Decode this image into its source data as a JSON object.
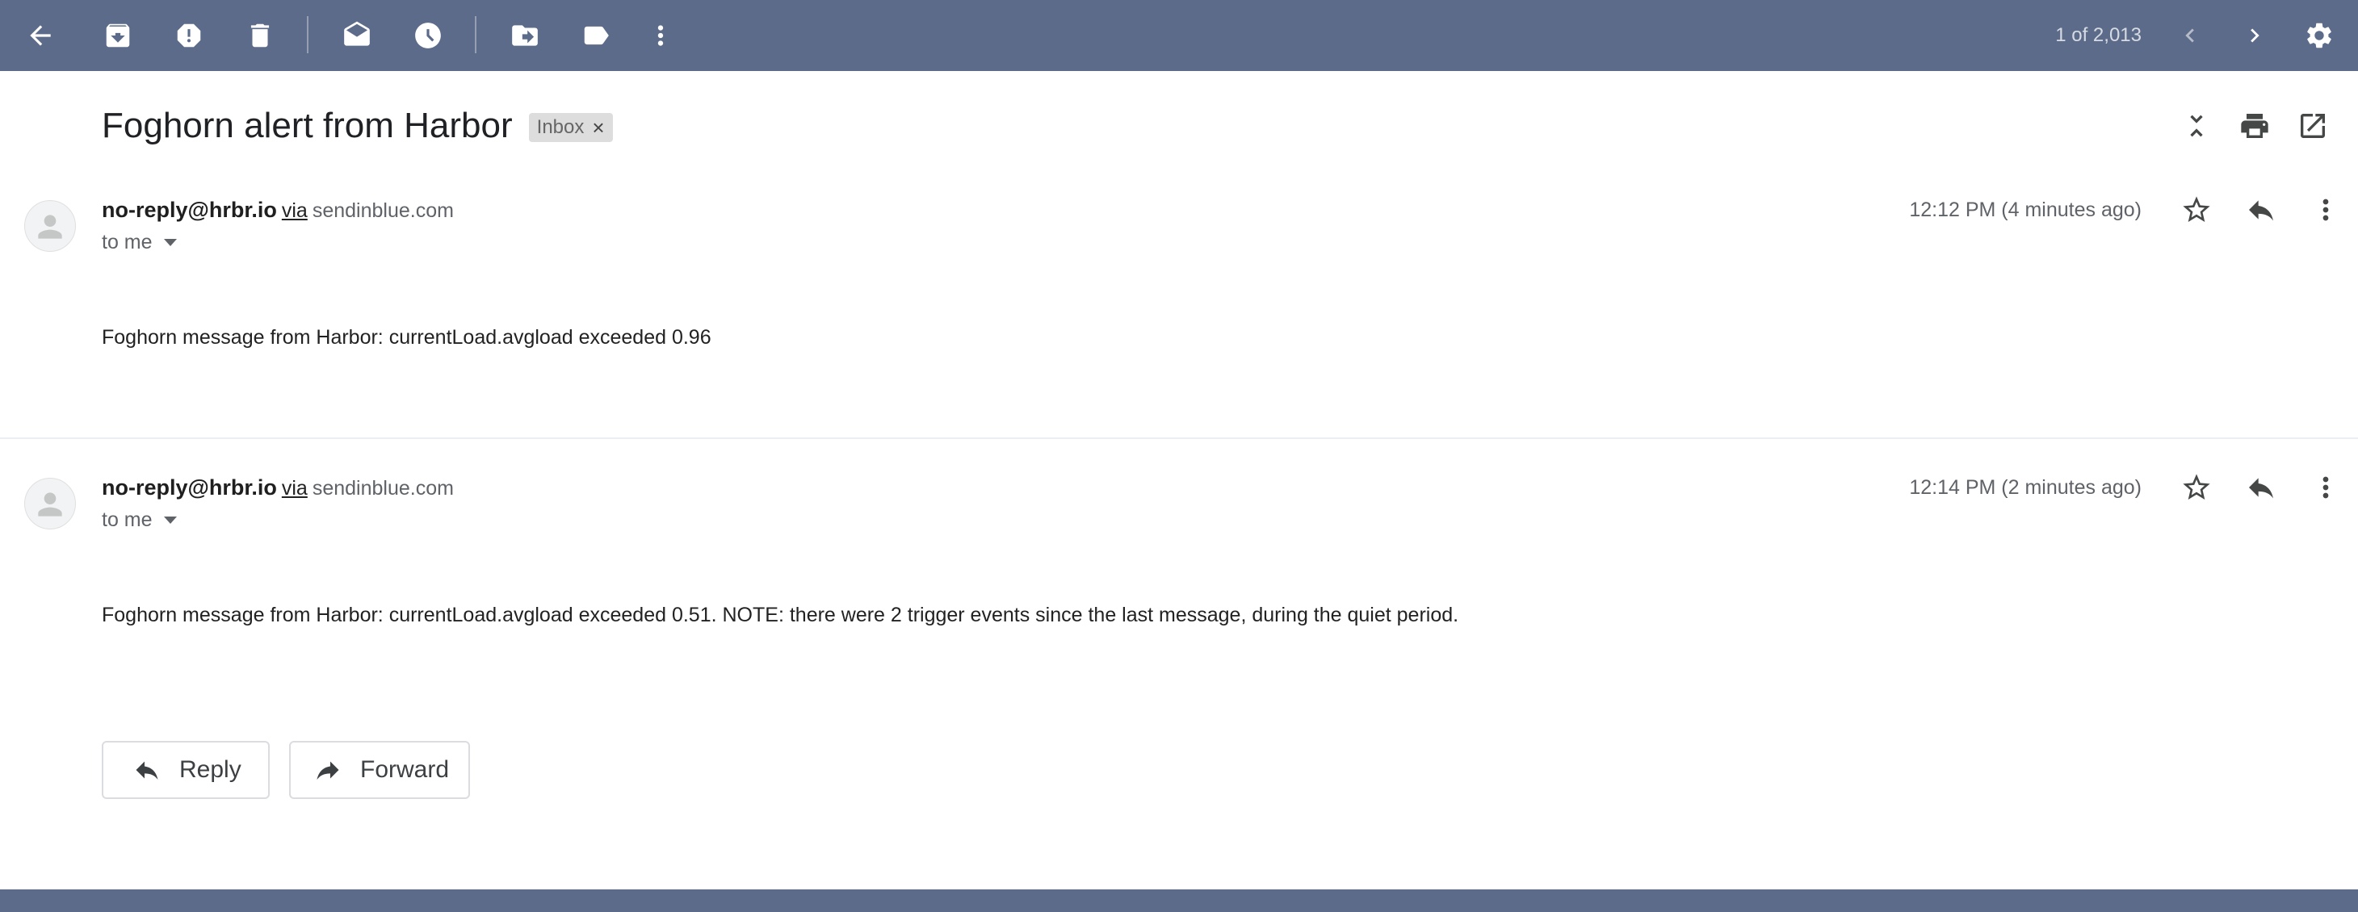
{
  "toolbar": {
    "icons": [
      "back-arrow-icon",
      "archive-icon",
      "report-spam-icon",
      "delete-icon",
      "mark-unread-icon",
      "snooze-icon",
      "move-to-icon",
      "label-icon",
      "more-vert-icon"
    ],
    "pager": "1 of 2,013",
    "pager_icons": [
      "prev-chevron-icon",
      "next-chevron-icon"
    ],
    "settings_icon": "gear-icon"
  },
  "thread": {
    "subject": "Foghorn alert from Harbor",
    "label": "Inbox",
    "label_remove": "×",
    "actions": [
      "collapse-all-icon",
      "print-icon",
      "open-in-new-window-icon"
    ]
  },
  "messages": [
    {
      "sender": "no-reply@hrbr.io",
      "via": "via",
      "via_domain": "sendinblue.com",
      "to": "to me",
      "time": "12:12 PM (4 minutes ago)",
      "body": "Foghorn message from Harbor: currentLoad.avgload exceeded 0.96"
    },
    {
      "sender": "no-reply@hrbr.io",
      "via": "via",
      "via_domain": "sendinblue.com",
      "to": "to me",
      "time": "12:14 PM (2 minutes ago)",
      "body": "Foghorn message from Harbor: currentLoad.avgload exceeded 0.51. NOTE: there were 2 trigger events since the last message, during the quiet period."
    }
  ],
  "buttons": {
    "reply": "Reply",
    "forward": "Forward"
  },
  "colors": {
    "toolbar_bg": "#5c6b8a",
    "text_primary": "#202124",
    "text_secondary": "#5f6368"
  }
}
